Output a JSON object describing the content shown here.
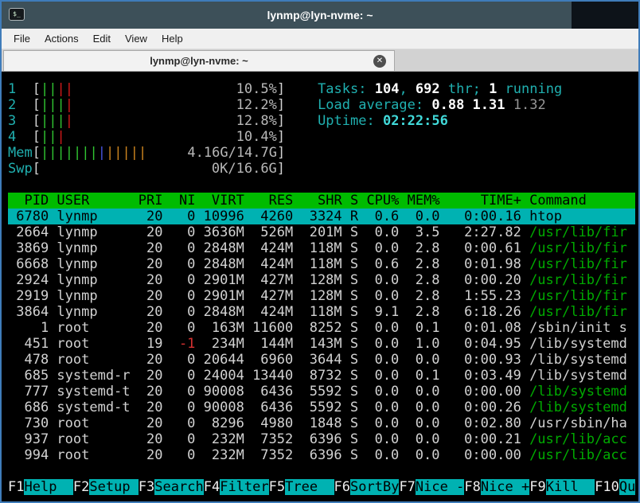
{
  "window": {
    "title": "lynmp@lyn-nvme: ~",
    "icon_glyph": "$_"
  },
  "menu": {
    "items": [
      "File",
      "Actions",
      "Edit",
      "View",
      "Help"
    ]
  },
  "tab": {
    "title": "lynmp@lyn-nvme: ~",
    "close_glyph": "✕"
  },
  "colors": {
    "accent_border": "#3f7cba",
    "titlebar_bg": "#3d5059",
    "header_bg": "#00bb00",
    "selection_bg": "#00b2b2",
    "function_key_bg": "#00b2b2",
    "bar_green": "#30c431",
    "bar_red": "#d01a1a",
    "bar_blue": "#4653de",
    "bar_orange": "#cc841f",
    "label_cyan": "#20b0b0",
    "command_green": "#00ab00",
    "nice_red": "#d63131"
  },
  "htop": {
    "meters": {
      "cpus": [
        {
          "label": "1",
          "percent": "10.5%",
          "bars": [
            "green",
            "green",
            "red",
            "red"
          ]
        },
        {
          "label": "2",
          "percent": "12.2%",
          "bars": [
            "green",
            "green",
            "green",
            "red"
          ]
        },
        {
          "label": "3",
          "percent": "12.8%",
          "bars": [
            "green",
            "green",
            "green",
            "red"
          ]
        },
        {
          "label": "4",
          "percent": "10.4%",
          "bars": [
            "green",
            "green",
            "red"
          ]
        }
      ],
      "mem": {
        "label": "Mem",
        "value": "4.16G/14.7G",
        "bars": [
          "green",
          "green",
          "green",
          "green",
          "green",
          "green",
          "green",
          "blue",
          "orange",
          "orange",
          "orange",
          "orange",
          "orange"
        ]
      },
      "swp": {
        "label": "Swp",
        "value": "0K/16.6G",
        "bars": []
      }
    },
    "summary_lines": [
      {
        "name": "tasks-summary",
        "segments": [
          [
            "Tasks: ",
            "cyan"
          ],
          [
            "104",
            "boldwhite"
          ],
          [
            ", ",
            "cyan"
          ],
          [
            "692",
            "boldwhite"
          ],
          [
            " thr; ",
            "cyan"
          ],
          [
            "1",
            "boldwhite"
          ],
          [
            " running",
            "cyan"
          ]
        ]
      },
      {
        "name": "load-average",
        "segments": [
          [
            "Load average: ",
            "cyan"
          ],
          [
            "0.88 ",
            "boldwhite"
          ],
          [
            "1.31 ",
            "boldwhite"
          ],
          [
            "1.32",
            "dim"
          ]
        ]
      },
      {
        "name": "uptime",
        "segments": [
          [
            "Uptime: ",
            "cyan"
          ],
          [
            "02:22:56",
            "boldcyan"
          ]
        ]
      }
    ],
    "table": {
      "headers": {
        "pid": "PID",
        "user": "USER",
        "pri": "PRI",
        "ni": "NI",
        "virt": "VIRT",
        "res": "RES",
        "shr": "SHR",
        "s": "S",
        "cpu": "CPU%",
        "mem": "MEM%",
        "time": "TIME+",
        "command": "Command"
      },
      "rows": [
        {
          "pid": "6780",
          "user": "lynmp",
          "pri": "20",
          "ni": "0",
          "virt": "10996",
          "res": "4260",
          "shr": "3324",
          "s": "R",
          "cpu": "0.6",
          "mem": "0.0",
          "time": "0:00.16",
          "cmd": "htop",
          "cmd_color": "white",
          "selected": true
        },
        {
          "pid": "2664",
          "user": "lynmp",
          "pri": "20",
          "ni": "0",
          "virt": "3636M",
          "res": "526M",
          "shr": "201M",
          "s": "S",
          "cpu": "0.0",
          "mem": "3.5",
          "time": "2:27.82",
          "cmd": "/usr/lib/fir",
          "cmd_color": "green"
        },
        {
          "pid": "3869",
          "user": "lynmp",
          "pri": "20",
          "ni": "0",
          "virt": "2848M",
          "res": "424M",
          "shr": "118M",
          "s": "S",
          "cpu": "0.0",
          "mem": "2.8",
          "time": "0:00.61",
          "cmd": "/usr/lib/fir",
          "cmd_color": "green"
        },
        {
          "pid": "6668",
          "user": "lynmp",
          "pri": "20",
          "ni": "0",
          "virt": "2848M",
          "res": "424M",
          "shr": "118M",
          "s": "S",
          "cpu": "0.6",
          "mem": "2.8",
          "time": "0:01.98",
          "cmd": "/usr/lib/fir",
          "cmd_color": "green"
        },
        {
          "pid": "2924",
          "user": "lynmp",
          "pri": "20",
          "ni": "0",
          "virt": "2901M",
          "res": "427M",
          "shr": "128M",
          "s": "S",
          "cpu": "0.0",
          "mem": "2.8",
          "time": "0:00.20",
          "cmd": "/usr/lib/fir",
          "cmd_color": "green"
        },
        {
          "pid": "2919",
          "user": "lynmp",
          "pri": "20",
          "ni": "0",
          "virt": "2901M",
          "res": "427M",
          "shr": "128M",
          "s": "S",
          "cpu": "0.0",
          "mem": "2.8",
          "time": "1:55.23",
          "cmd": "/usr/lib/fir",
          "cmd_color": "green"
        },
        {
          "pid": "3864",
          "user": "lynmp",
          "pri": "20",
          "ni": "0",
          "virt": "2848M",
          "res": "424M",
          "shr": "118M",
          "s": "S",
          "cpu": "9.1",
          "mem": "2.8",
          "time": "6:18.26",
          "cmd": "/usr/lib/fir",
          "cmd_color": "green"
        },
        {
          "pid": "1",
          "user": "root",
          "pri": "20",
          "ni": "0",
          "virt": "163M",
          "res": "11600",
          "shr": "8252",
          "s": "S",
          "cpu": "0.0",
          "mem": "0.1",
          "time": "0:01.08",
          "cmd": "/sbin/init s",
          "cmd_color": "white"
        },
        {
          "pid": "451",
          "user": "root",
          "pri": "19",
          "ni": "-1",
          "ni_color": "red",
          "virt": "234M",
          "res": "144M",
          "shr": "143M",
          "s": "S",
          "cpu": "0.0",
          "mem": "1.0",
          "time": "0:04.95",
          "cmd": "/lib/systemd",
          "cmd_color": "white"
        },
        {
          "pid": "478",
          "user": "root",
          "pri": "20",
          "ni": "0",
          "virt": "20644",
          "res": "6960",
          "shr": "3644",
          "s": "S",
          "cpu": "0.0",
          "mem": "0.0",
          "time": "0:00.93",
          "cmd": "/lib/systemd",
          "cmd_color": "white"
        },
        {
          "pid": "685",
          "user": "systemd-r",
          "pri": "20",
          "ni": "0",
          "virt": "24004",
          "res": "13440",
          "shr": "8732",
          "s": "S",
          "cpu": "0.0",
          "mem": "0.1",
          "time": "0:03.49",
          "cmd": "/lib/systemd",
          "cmd_color": "white"
        },
        {
          "pid": "777",
          "user": "systemd-t",
          "pri": "20",
          "ni": "0",
          "virt": "90008",
          "res": "6436",
          "shr": "5592",
          "s": "S",
          "cpu": "0.0",
          "mem": "0.0",
          "time": "0:00.00",
          "cmd": "/lib/systemd",
          "cmd_color": "green"
        },
        {
          "pid": "686",
          "user": "systemd-t",
          "pri": "20",
          "ni": "0",
          "virt": "90008",
          "res": "6436",
          "shr": "5592",
          "s": "S",
          "cpu": "0.0",
          "mem": "0.0",
          "time": "0:00.26",
          "cmd": "/lib/systemd",
          "cmd_color": "green"
        },
        {
          "pid": "730",
          "user": "root",
          "pri": "20",
          "ni": "0",
          "virt": "8296",
          "res": "4980",
          "shr": "1848",
          "s": "S",
          "cpu": "0.0",
          "mem": "0.0",
          "time": "0:02.80",
          "cmd": "/usr/sbin/ha",
          "cmd_color": "white"
        },
        {
          "pid": "937",
          "user": "root",
          "pri": "20",
          "ni": "0",
          "virt": "232M",
          "res": "7352",
          "shr": "6396",
          "s": "S",
          "cpu": "0.0",
          "mem": "0.0",
          "time": "0:00.21",
          "cmd": "/usr/lib/acc",
          "cmd_color": "green"
        },
        {
          "pid": "994",
          "user": "root",
          "pri": "20",
          "ni": "0",
          "virt": "232M",
          "res": "7352",
          "shr": "6396",
          "s": "S",
          "cpu": "0.0",
          "mem": "0.0",
          "time": "0:00.00",
          "cmd": "/usr/lib/acc",
          "cmd_color": "green"
        }
      ]
    },
    "fkeys": [
      {
        "key": "F1",
        "label": "Help"
      },
      {
        "key": "F2",
        "label": "Setup"
      },
      {
        "key": "F3",
        "label": "Search"
      },
      {
        "key": "F4",
        "label": "Filter"
      },
      {
        "key": "F5",
        "label": "Tree"
      },
      {
        "key": "F6",
        "label": "SortBy"
      },
      {
        "key": "F7",
        "label": "Nice -"
      },
      {
        "key": "F8",
        "label": "Nice +"
      },
      {
        "key": "F9",
        "label": "Kill"
      },
      {
        "key": "F10",
        "label": "Qu"
      }
    ]
  }
}
